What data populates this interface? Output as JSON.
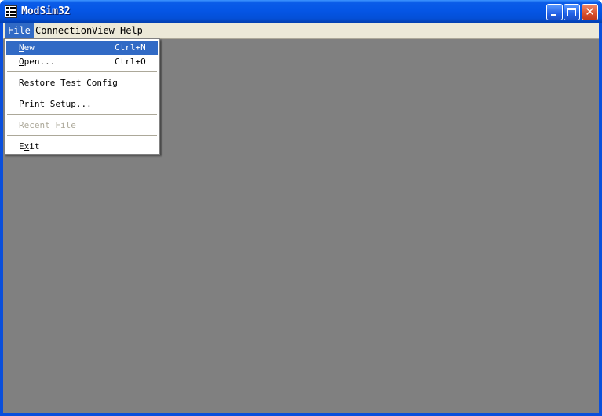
{
  "window": {
    "title": "ModSim32",
    "icon": "app-grid-icon",
    "controls": [
      "minimize-icon",
      "maximize-icon",
      "close-icon"
    ]
  },
  "menubar": {
    "items": [
      {
        "label": "File",
        "underline": "F",
        "active": true
      },
      {
        "label": "Connection",
        "underline": "C",
        "active": false
      },
      {
        "label": "View",
        "underline": "V",
        "active": false
      },
      {
        "label": "Help",
        "underline": "H",
        "active": false
      }
    ]
  },
  "file_menu": {
    "items": [
      {
        "label": "New",
        "accel": "Ctrl+N",
        "highlighted": true,
        "disabled": false
      },
      {
        "label": "Open...",
        "accel": "Ctrl+O",
        "highlighted": false,
        "disabled": false
      },
      {
        "label": "Restore Test Config",
        "accel": "",
        "highlighted": false,
        "disabled": false
      },
      {
        "label": "Print Setup...",
        "accel": "",
        "highlighted": false,
        "disabled": false
      },
      {
        "label": "Recent File",
        "accel": "",
        "highlighted": false,
        "disabled": true
      },
      {
        "label": "Exit",
        "accel": "",
        "highlighted": false,
        "disabled": false
      }
    ]
  },
  "colors": {
    "titlebar": "#0556e6",
    "menu_highlight": "#316ac5",
    "menubar_bg": "#ece9d8",
    "client_bg": "#808080",
    "disabled_text": "#aca899"
  }
}
